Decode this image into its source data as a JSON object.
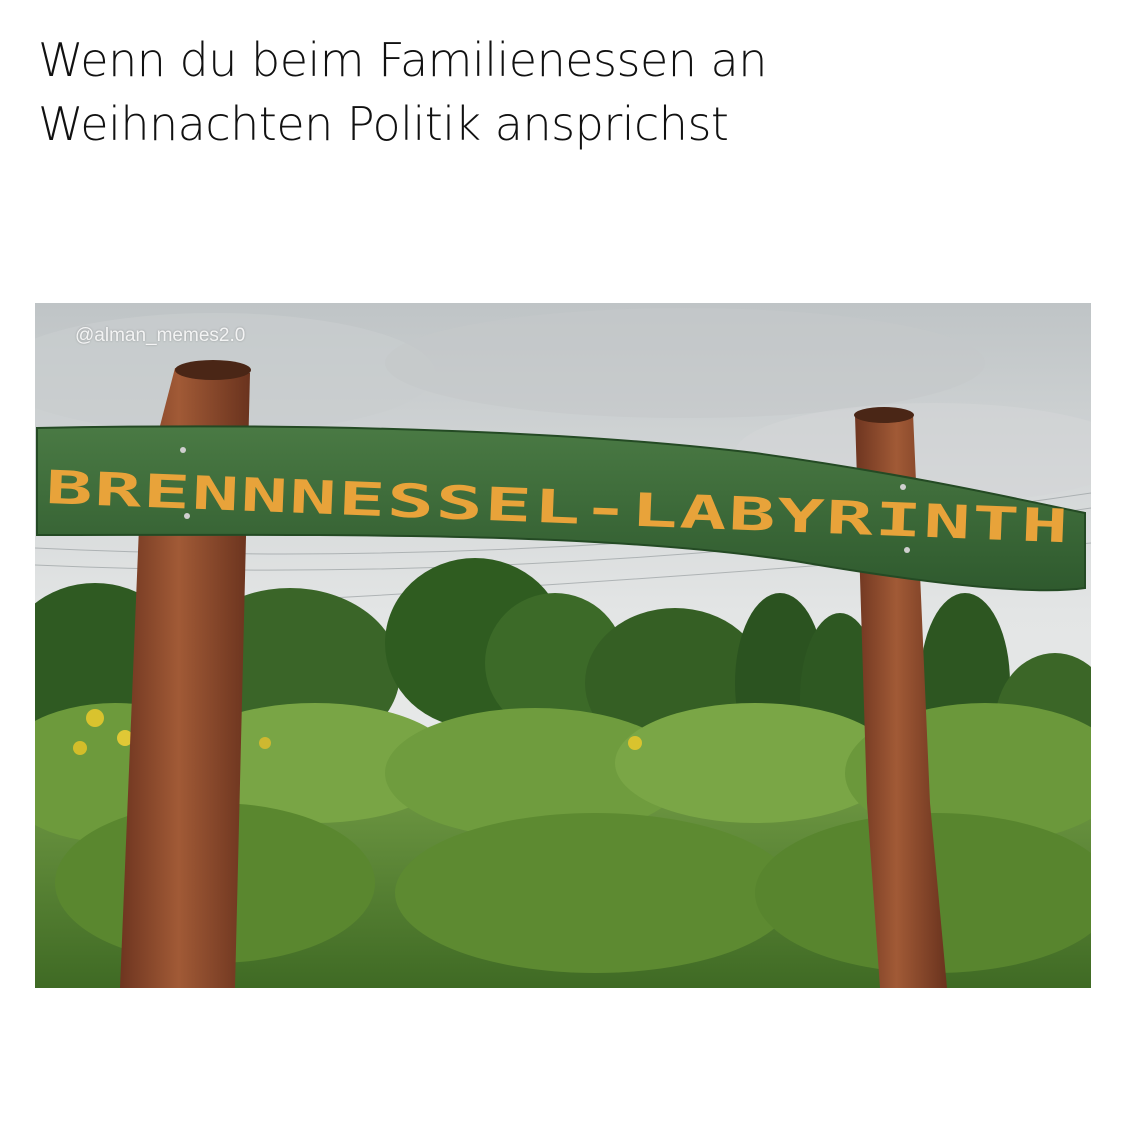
{
  "caption": {
    "line1": "Wenn du beim Familienessen an",
    "line2": "Weihnachten Politik ansprichst"
  },
  "photo": {
    "watermark": "@alman_memes2.0",
    "sign_text": "BRENNNESSEL-LABYRINTH"
  },
  "colors": {
    "sign_green": "#3d6b3a",
    "sign_letters": "#e8a33a",
    "post_brown": "#8a4a2c",
    "sky": "#dcdfdf",
    "foliage": "#5f8a34"
  }
}
